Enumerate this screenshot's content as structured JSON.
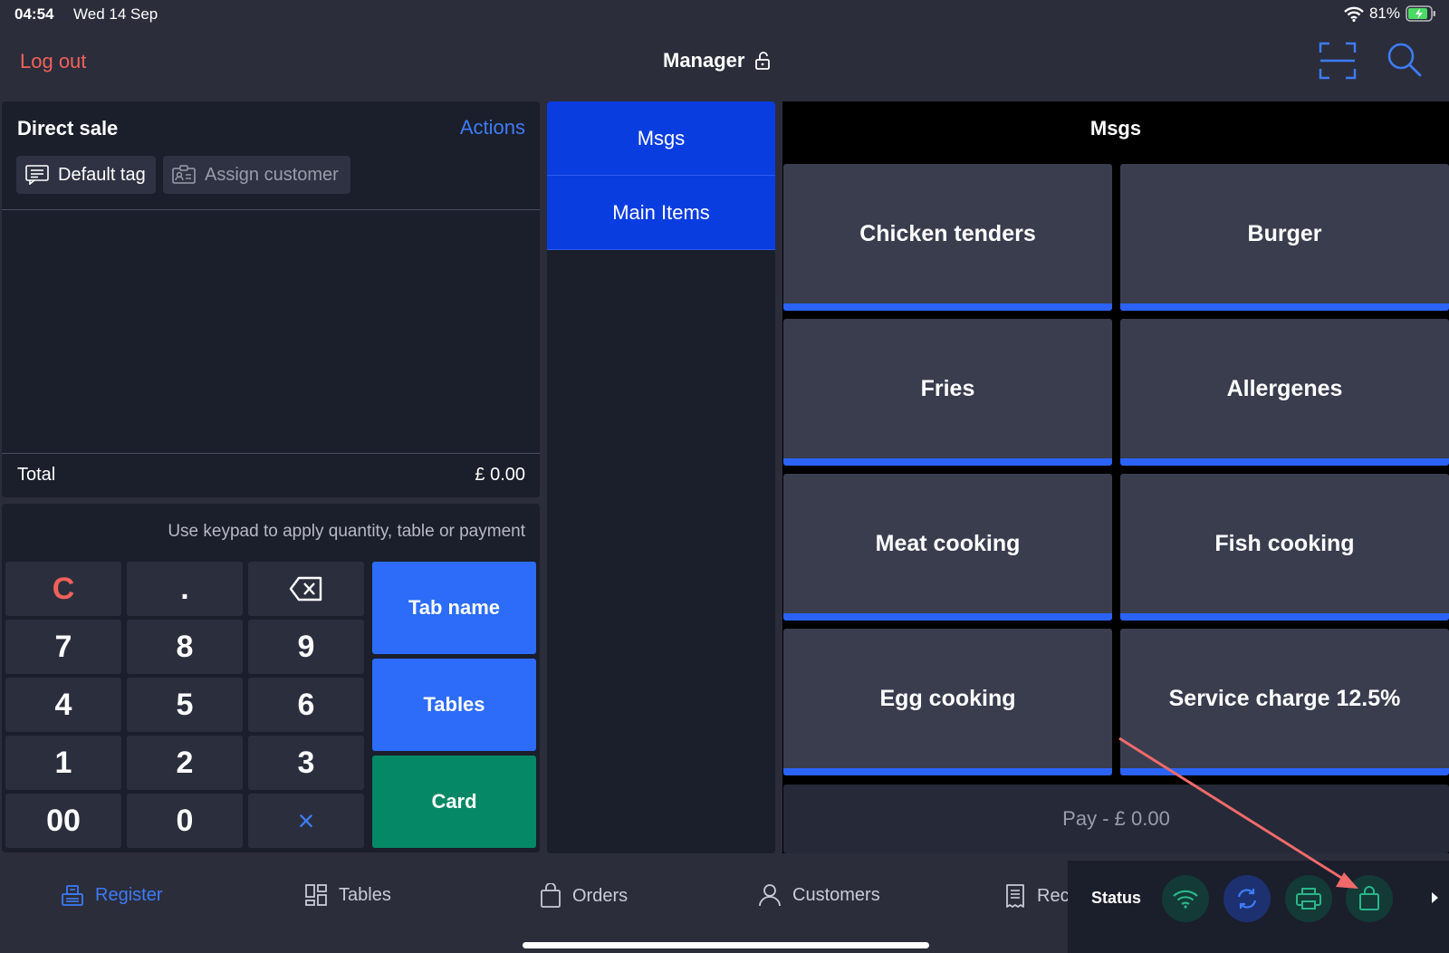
{
  "status_bar": {
    "time": "04:54",
    "date": "Wed 14 Sep",
    "battery": "81%"
  },
  "header": {
    "logout": "Log out",
    "user": "Manager"
  },
  "ticket": {
    "title": "Direct sale",
    "actions": "Actions",
    "tag": "Default tag",
    "assign": "Assign customer",
    "total_label": "Total",
    "total_value": "£ 0.00"
  },
  "keypad": {
    "hint": "Use keypad to apply quantity, table or payment",
    "clear": "C",
    "dot": ".",
    "keys": [
      "7",
      "8",
      "9",
      "4",
      "5",
      "6",
      "1",
      "2",
      "3",
      "00",
      "0"
    ],
    "multiply": "×",
    "tab_name": "Tab name",
    "tables": "Tables",
    "card": "Card"
  },
  "categories": [
    "Msgs",
    "Main Items"
  ],
  "items_panel": {
    "title": "Msgs",
    "tiles": [
      "Chicken tenders",
      "Burger",
      "Fries",
      "Allergenes",
      "Meat cooking",
      "Fish cooking",
      "Egg cooking",
      "Service charge 12.5%"
    ],
    "pay": "Pay - £ 0.00"
  },
  "nav": {
    "register": "Register",
    "tables": "Tables",
    "orders": "Orders",
    "customers": "Customers",
    "receipts": "Rec",
    "status": "Status"
  },
  "colors": {
    "accent_blue": "#2c6cf8",
    "category_blue": "#0a3de0",
    "card_green": "#058865",
    "logout_red": "#f0615a",
    "status_green": "#2bb589"
  },
  "icons": [
    "wifi-icon",
    "battery-icon",
    "unlock-icon",
    "scan-icon",
    "search-icon",
    "tag-icon",
    "customer-card-icon",
    "backspace-icon",
    "register-icon",
    "tables-icon",
    "orders-icon",
    "customers-icon",
    "receipts-icon",
    "sync-icon",
    "printer-icon",
    "bag-icon",
    "chevron-right-icon"
  ]
}
